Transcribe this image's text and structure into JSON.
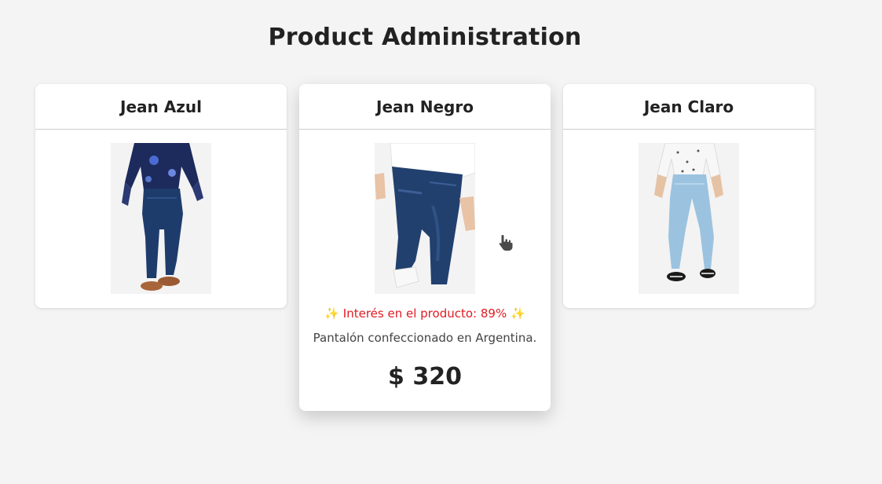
{
  "page": {
    "title": "Product Administration"
  },
  "products": [
    {
      "name": "Jean Azul",
      "image": "blue-jeans-photo",
      "expanded": false
    },
    {
      "name": "Jean Negro",
      "image": "dark-jeans-photo",
      "expanded": true,
      "interest": "✨ Interés en el producto: 89% ✨",
      "description": "Pantalón confeccionado en Argentina.",
      "price": "$ 320"
    },
    {
      "name": "Jean Claro",
      "image": "light-jeans-photo",
      "expanded": false
    }
  ],
  "colors": {
    "background": "#f4f4f4",
    "card": "#ffffff",
    "interest_text": "#e01a22",
    "title_text": "#222222"
  },
  "cursor": "hand-pointer-icon"
}
